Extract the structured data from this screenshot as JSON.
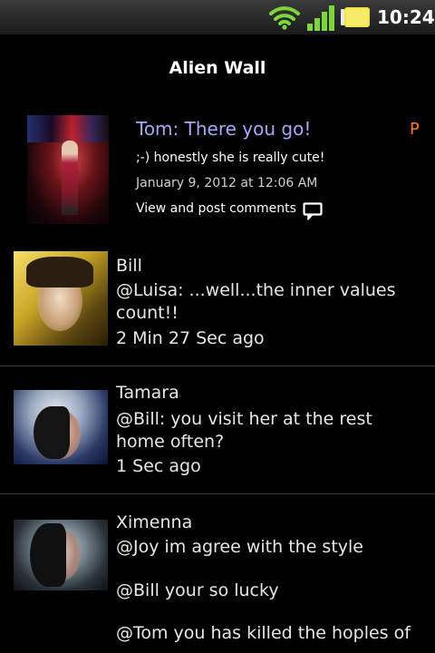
{
  "status_bar": {
    "time": "10:24"
  },
  "header": {
    "title": "Alien Wall"
  },
  "featured_post": {
    "poster": "Tom: There you go!",
    "badge": "P",
    "text": ";-) honestly she is really cute!",
    "date": "January 9, 2012 at 12:06 AM",
    "comments_link": "View and post comments"
  },
  "feed": [
    {
      "name": "Bill",
      "message": "@Luisa: ...well...the inner values count!!",
      "time": "2 Min 27 Sec ago"
    },
    {
      "name": "Tamara",
      "message": "@Bill: you visit her at the rest home often?",
      "time": "1 Sec ago"
    },
    {
      "name": "Ximenna",
      "message_lines": [
        "@Joy im agree with the style",
        "@Bill your so lucky",
        "@Tom you has killed the hoples of"
      ]
    }
  ],
  "colors": {
    "background": "#000000",
    "poster_name": "#a7a7f5",
    "badge": "#ff7a1a",
    "divider": "#3a3a3a"
  }
}
